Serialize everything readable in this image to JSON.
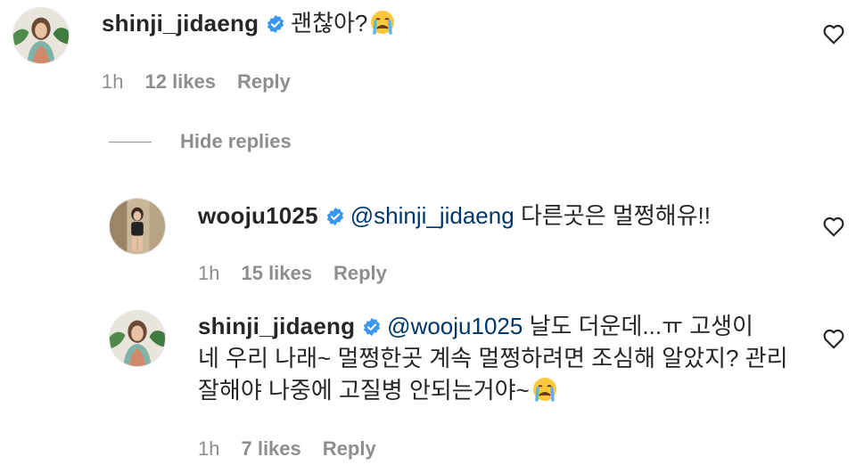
{
  "comments": [
    {
      "username": "shinji_jidaeng",
      "mention": "",
      "text": "괜찮아?",
      "emoji": "crying-face",
      "time": "1h",
      "likes": "12 likes",
      "reply": "Reply"
    },
    {
      "username": "wooju1025",
      "mention": "@shinji_jidaeng",
      "text": "다른곳은 멀쩡해유!!",
      "emoji": "",
      "time": "1h",
      "likes": "15 likes",
      "reply": "Reply"
    },
    {
      "username": "shinji_jidaeng",
      "mention": "@wooju1025",
      "text_line1": "날도 더운데...ㅠ 고생이",
      "text_line2": "네 우리 나래~ 멀쩡한곳 계속 멀쩡하려면 조심해 알았지? 관리",
      "text_line3": "잘해야 나중에 고질병 안되는거야~",
      "emoji": "crying-face",
      "time": "1h",
      "likes": "7 likes",
      "reply": "Reply"
    }
  ],
  "hide_replies": "Hide replies",
  "colors": {
    "text": "#262626",
    "secondary": "#8e8e8e",
    "mention": "#00376b",
    "verified": "#3897f0"
  }
}
